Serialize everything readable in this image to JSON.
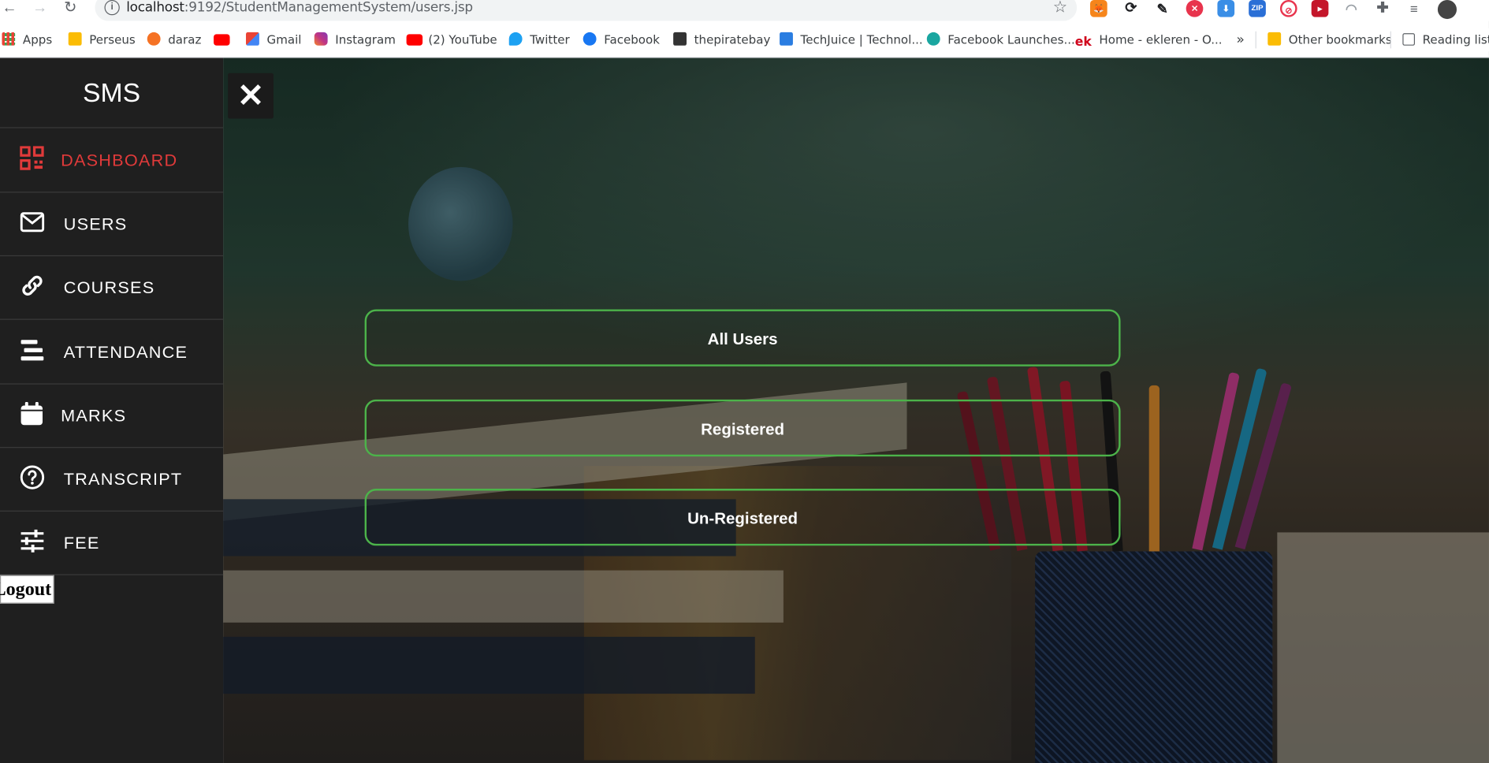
{
  "browser": {
    "url_host": "localhost",
    "url_rest": ":9192/StudentManagementSystem/users.jsp",
    "bookmarks": [
      {
        "label": "Apps",
        "icon": "apps-grid-icon",
        "color": "#e94235"
      },
      {
        "label": "Perseus",
        "icon": "folder-icon",
        "color": "#fbbc04"
      },
      {
        "label": "daraz",
        "icon": "daraz-icon",
        "color": "#f57224"
      },
      {
        "label": "",
        "icon": "youtube-icon",
        "color": "#ff0000"
      },
      {
        "label": "Gmail",
        "icon": "gmail-icon",
        "color": "#ea4335"
      },
      {
        "label": "Instagram",
        "icon": "instagram-icon",
        "color": "#c13584"
      },
      {
        "label": "(2) YouTube",
        "icon": "youtube-icon",
        "color": "#ff0000"
      },
      {
        "label": "Twitter",
        "icon": "twitter-icon",
        "color": "#1da1f2"
      },
      {
        "label": "Facebook",
        "icon": "facebook-icon",
        "color": "#1877f2"
      },
      {
        "label": "thepiratebay",
        "icon": "pirate-ship-icon",
        "color": "#333333"
      },
      {
        "label": "TechJuice | Technol...",
        "icon": "techjuice-icon",
        "color": "#2a7de1"
      },
      {
        "label": "Facebook Launches...",
        "icon": "wave-icon",
        "color": "#1aa6a0"
      },
      {
        "label": "Home - ekleren - O...",
        "icon": "ek-icon",
        "color": "#d0021b"
      }
    ],
    "overflow": "»",
    "other_bookmarks": "Other bookmarks",
    "reading_list": "Reading list"
  },
  "sidebar": {
    "brand": "SMS",
    "items": [
      {
        "label": "DASHBOARD",
        "icon": "qr-grid-icon",
        "active": true
      },
      {
        "label": "USERS",
        "icon": "envelope-icon",
        "active": false
      },
      {
        "label": "COURSES",
        "icon": "link-icon",
        "active": false
      },
      {
        "label": "ATTENDANCE",
        "icon": "bars-icon",
        "active": false
      },
      {
        "label": "MARKS",
        "icon": "calendar-icon",
        "active": false
      },
      {
        "label": "TRANSCRIPT",
        "icon": "question-circle-icon",
        "active": false
      },
      {
        "label": "FEE",
        "icon": "sliders-icon",
        "active": false
      }
    ],
    "logout": "Logout"
  },
  "main": {
    "close": "✕",
    "options": [
      "All Users",
      "Registered",
      "Un-Registered"
    ]
  },
  "colors": {
    "accent_active": "#e03a3a",
    "option_border": "#4cb34a",
    "sidebar_bg": "#1f1f1f"
  }
}
